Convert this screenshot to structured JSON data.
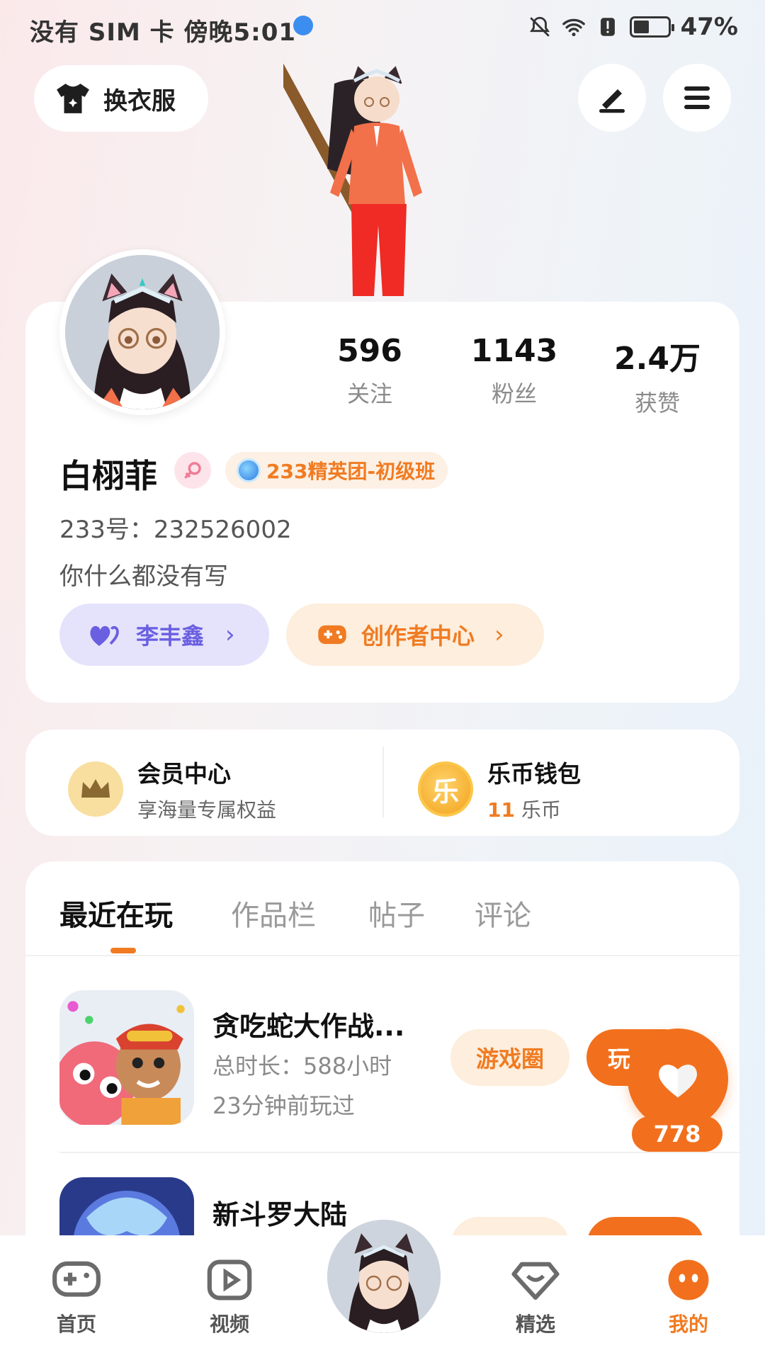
{
  "status_bar": {
    "carrier_time": "没有 SIM 卡 傍晚5:01",
    "battery": "47%",
    "battery_level": 0.47,
    "icons": [
      "globe-icon",
      "mute-bell-icon",
      "wifi-icon",
      "alert-icon",
      "battery-icon"
    ]
  },
  "header": {
    "change_clothes_label": "换衣服",
    "icons": [
      "shirt-icon",
      "edit-pen-icon",
      "menu-icon"
    ]
  },
  "profile": {
    "stats": [
      {
        "value": "596",
        "label": "关注"
      },
      {
        "value": "1143",
        "label": "粉丝"
      },
      {
        "value": "2.4万",
        "label": "获赞"
      }
    ],
    "name": "白栩菲",
    "badge": "233精英团-初级班",
    "uid": "233号：232526002",
    "bio": "你什么都没有写",
    "buttons": [
      {
        "label": "李丰鑫",
        "icon": "hearts-icon"
      },
      {
        "label": "创作者中心",
        "icon": "gamepad-icon"
      }
    ]
  },
  "member": {
    "vip_title": "会员中心",
    "vip_sub": "享海量专属权益",
    "wallet_title": "乐币钱包",
    "wallet_amount": "11",
    "wallet_unit": "乐币",
    "coin_char": "乐"
  },
  "tabs": [
    "最近在玩",
    "作品栏",
    "帖子",
    "评论"
  ],
  "games": [
    {
      "title": "贪吃蛇大作战...",
      "duration": "总时长：588小时",
      "last_played": "23分钟前玩过",
      "circle_btn": "游戏圈",
      "play_btn": "玩"
    },
    {
      "title": "新斗罗大陆"
    }
  ],
  "fab": {
    "count": "778"
  },
  "bottom_nav": [
    {
      "label": "首页",
      "icon": "gamepad-icon"
    },
    {
      "label": "视频",
      "icon": "video-play-icon"
    },
    {
      "label": "精选",
      "icon": "heart-diamond-icon"
    },
    {
      "label": "我的",
      "icon": "me-face-icon"
    }
  ],
  "colors": {
    "accent": "#f2701d",
    "accent_text": "#f07b22",
    "purple": "#6a5fe0"
  }
}
